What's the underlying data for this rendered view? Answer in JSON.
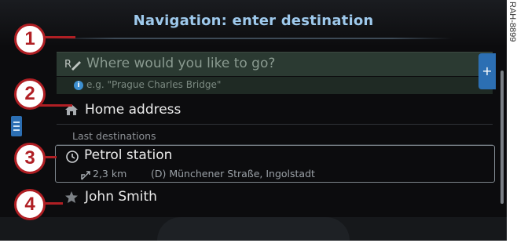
{
  "header": {
    "title": "Navigation: enter destination"
  },
  "search": {
    "placeholder": "Where would you like to go?",
    "hint": "e.g. \"Prague Charles Bridge\"",
    "add_label": "+"
  },
  "home": {
    "label": "Home address"
  },
  "last_destinations": {
    "heading": "Last destinations",
    "items": [
      {
        "name": "Petrol station",
        "distance": "2,3 km",
        "address": "(D) Münchener Straße, Ingolstadt",
        "icon": "history-clock-icon"
      },
      {
        "name": "John Smith",
        "icon": "favorite-star-icon"
      }
    ]
  },
  "callouts": [
    "1",
    "2",
    "3",
    "4"
  ],
  "figure_code": "RAH-8899",
  "colors": {
    "title": "#9ec9ec",
    "accent_blue": "#2c6fb3",
    "callout_red": "#b01f24"
  }
}
